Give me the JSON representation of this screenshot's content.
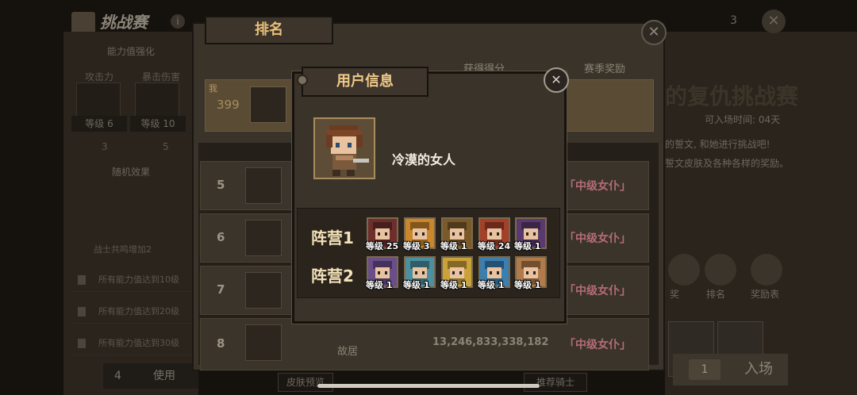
{
  "background": {
    "title": "挑战赛",
    "section_label": "能力值强化",
    "stats": [
      {
        "name": "攻击力",
        "grade": "等级 6",
        "count": "3"
      },
      {
        "name": "暴击伤害",
        "grade": "等级 10",
        "count": "5"
      }
    ],
    "random_effect_label": "随机效果",
    "lock_rows": [
      "所有能力值达到10级",
      "所有能力值达到20级",
      "所有能力值达到30级"
    ],
    "warrior_note": "战士共鸣增加2",
    "use_count": "4",
    "use_label": "使用",
    "right_title": "的复仇挑战赛",
    "right_time": "可入场时间: 04天",
    "right_desc_1": "的誓文, 和她进行挑战吧!",
    "right_desc_2": "誓文皮肤及各种各样的奖励。",
    "right_icons": [
      "奖",
      "排名",
      "奖励表"
    ],
    "right_reward_label": "奖励",
    "enter_count": "1",
    "enter_label": "入场",
    "top_right_num": "3",
    "bottom_tabs": [
      "皮肤预览",
      "推荐骑士"
    ]
  },
  "ranking": {
    "tab_label": "排名",
    "col_score": "获得得分",
    "col_reward": "赛季奖励",
    "my_row": {
      "me_label": "我",
      "rank": "399"
    },
    "rows": [
      {
        "rank": "5",
        "name": "",
        "score": "",
        "reward": "「中级女仆」"
      },
      {
        "rank": "6",
        "name": "",
        "score": "",
        "reward": "「中级女仆」"
      },
      {
        "rank": "7",
        "name": "",
        "score": "",
        "reward": "「中级女仆」"
      },
      {
        "rank": "8",
        "name": "故居",
        "score": "13,246,833,338,182",
        "reward": "「中级女仆」"
      }
    ]
  },
  "modal": {
    "title": "用户信息",
    "user_name": "冷漠的女人",
    "camps": [
      {
        "label": "阵营1",
        "heroes": [
          {
            "level": "等级 25",
            "color": "#6e2f2c",
            "icon": "hero-brown-hair"
          },
          {
            "level": "等级 3",
            "color": "#c9862a",
            "icon": "hero-lion"
          },
          {
            "level": "等级 1",
            "color": "#7a5a2a",
            "icon": "hero-horned"
          },
          {
            "level": "等级 24",
            "color": "#a3402a",
            "icon": "hero-witch-hat"
          },
          {
            "level": "等级 1",
            "color": "#5a3a6e",
            "icon": "hero-dark-hat"
          }
        ]
      },
      {
        "label": "阵营2",
        "heroes": [
          {
            "level": "等级 1",
            "color": "#6a4e8a",
            "icon": "hero-gold-helmet"
          },
          {
            "level": "等级 1",
            "color": "#4b8fa0",
            "icon": "hero-teal-hair"
          },
          {
            "level": "等级 1",
            "color": "#c9a23a",
            "icon": "hero-blonde"
          },
          {
            "level": "等级 1",
            "color": "#3a7fb0",
            "icon": "hero-blue-hair"
          },
          {
            "level": "等级 1",
            "color": "#b07a4a",
            "icon": "hero-orange-hair"
          }
        ]
      }
    ]
  }
}
